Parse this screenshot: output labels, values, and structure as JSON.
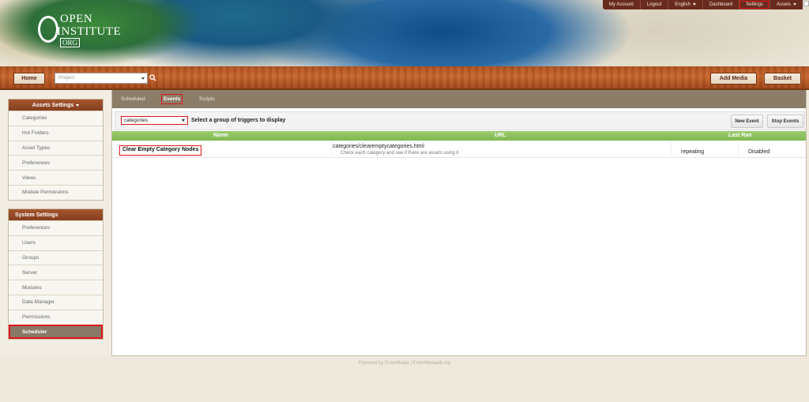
{
  "logo": {
    "line1": "OPEN",
    "line2": "INSTITUTE",
    "line3": "ORG"
  },
  "topmenu": {
    "items": [
      {
        "label": "My Account"
      },
      {
        "label": "Logout"
      },
      {
        "label": "English"
      },
      {
        "label": "Dashboard"
      },
      {
        "label": "Settings"
      },
      {
        "label": "Assets"
      }
    ]
  },
  "nav": {
    "home_label": "Home",
    "project_placeholder": "Project",
    "add_media_label": "Add Media",
    "basket_label": "Basket"
  },
  "assets_settings": {
    "title": "Assets Settings",
    "items": [
      "Categories",
      "Hot Folders",
      "Asset Types",
      "Preferences",
      "Views",
      "Module Permissions"
    ]
  },
  "system_settings": {
    "title": "System Settings",
    "items": [
      "Preferences",
      "Users",
      "Groups",
      "Server",
      "Modules",
      "Data Manager",
      "Permissions",
      "Scheduler"
    ],
    "active": "Scheduler"
  },
  "tabs": [
    "Scheduled",
    "Events",
    "Scripts"
  ],
  "active_tab": "Events",
  "toolbar": {
    "group_select_value": "categories",
    "label": "Select a group of triggers to display",
    "new_event_label": "New Event",
    "stop_events_label": "Stop Events"
  },
  "table": {
    "headers": {
      "name": "Name",
      "url": "URL",
      "last_ran": "Last Ran"
    },
    "rows": [
      {
        "name": "Clear Empty Category Nodes",
        "url": "categories/clearemptycategories.html",
        "description": "Check each category and see if there are assets using it",
        "frequency": "repeating",
        "status": "Disabled"
      }
    ]
  },
  "footer": {
    "text": "Powered by EnterMedia | EnterMediadb.org"
  },
  "colors": {
    "accent_red": "#e0161a",
    "wood": "#b0521f",
    "header_green": "#8bc35c",
    "tabbar": "#8b7d68"
  }
}
